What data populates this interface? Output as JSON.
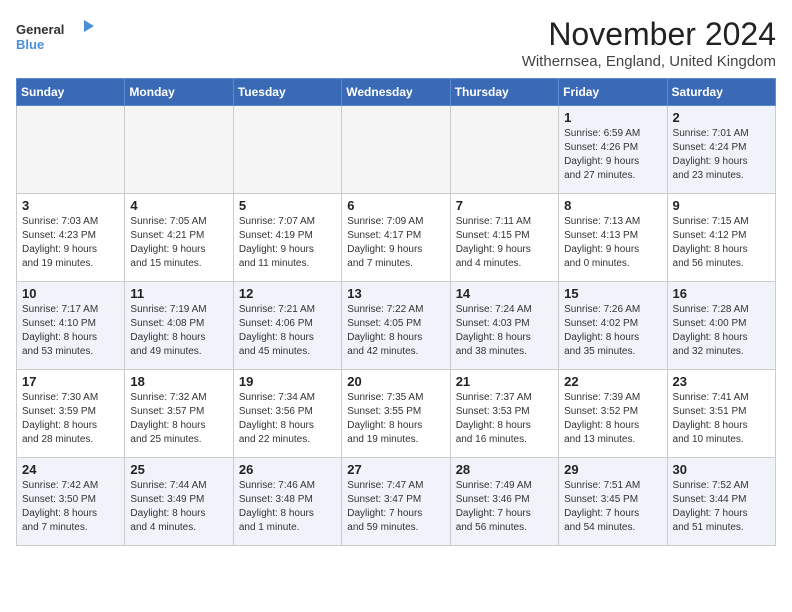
{
  "logo": {
    "line1": "General",
    "line2": "Blue"
  },
  "title": "November 2024",
  "location": "Withernsea, England, United Kingdom",
  "weekdays": [
    "Sunday",
    "Monday",
    "Tuesday",
    "Wednesday",
    "Thursday",
    "Friday",
    "Saturday"
  ],
  "weeks": [
    [
      {
        "day": "",
        "info": ""
      },
      {
        "day": "",
        "info": ""
      },
      {
        "day": "",
        "info": ""
      },
      {
        "day": "",
        "info": ""
      },
      {
        "day": "",
        "info": ""
      },
      {
        "day": "1",
        "info": "Sunrise: 6:59 AM\nSunset: 4:26 PM\nDaylight: 9 hours\nand 27 minutes."
      },
      {
        "day": "2",
        "info": "Sunrise: 7:01 AM\nSunset: 4:24 PM\nDaylight: 9 hours\nand 23 minutes."
      }
    ],
    [
      {
        "day": "3",
        "info": "Sunrise: 7:03 AM\nSunset: 4:23 PM\nDaylight: 9 hours\nand 19 minutes."
      },
      {
        "day": "4",
        "info": "Sunrise: 7:05 AM\nSunset: 4:21 PM\nDaylight: 9 hours\nand 15 minutes."
      },
      {
        "day": "5",
        "info": "Sunrise: 7:07 AM\nSunset: 4:19 PM\nDaylight: 9 hours\nand 11 minutes."
      },
      {
        "day": "6",
        "info": "Sunrise: 7:09 AM\nSunset: 4:17 PM\nDaylight: 9 hours\nand 7 minutes."
      },
      {
        "day": "7",
        "info": "Sunrise: 7:11 AM\nSunset: 4:15 PM\nDaylight: 9 hours\nand 4 minutes."
      },
      {
        "day": "8",
        "info": "Sunrise: 7:13 AM\nSunset: 4:13 PM\nDaylight: 9 hours\nand 0 minutes."
      },
      {
        "day": "9",
        "info": "Sunrise: 7:15 AM\nSunset: 4:12 PM\nDaylight: 8 hours\nand 56 minutes."
      }
    ],
    [
      {
        "day": "10",
        "info": "Sunrise: 7:17 AM\nSunset: 4:10 PM\nDaylight: 8 hours\nand 53 minutes."
      },
      {
        "day": "11",
        "info": "Sunrise: 7:19 AM\nSunset: 4:08 PM\nDaylight: 8 hours\nand 49 minutes."
      },
      {
        "day": "12",
        "info": "Sunrise: 7:21 AM\nSunset: 4:06 PM\nDaylight: 8 hours\nand 45 minutes."
      },
      {
        "day": "13",
        "info": "Sunrise: 7:22 AM\nSunset: 4:05 PM\nDaylight: 8 hours\nand 42 minutes."
      },
      {
        "day": "14",
        "info": "Sunrise: 7:24 AM\nSunset: 4:03 PM\nDaylight: 8 hours\nand 38 minutes."
      },
      {
        "day": "15",
        "info": "Sunrise: 7:26 AM\nSunset: 4:02 PM\nDaylight: 8 hours\nand 35 minutes."
      },
      {
        "day": "16",
        "info": "Sunrise: 7:28 AM\nSunset: 4:00 PM\nDaylight: 8 hours\nand 32 minutes."
      }
    ],
    [
      {
        "day": "17",
        "info": "Sunrise: 7:30 AM\nSunset: 3:59 PM\nDaylight: 8 hours\nand 28 minutes."
      },
      {
        "day": "18",
        "info": "Sunrise: 7:32 AM\nSunset: 3:57 PM\nDaylight: 8 hours\nand 25 minutes."
      },
      {
        "day": "19",
        "info": "Sunrise: 7:34 AM\nSunset: 3:56 PM\nDaylight: 8 hours\nand 22 minutes."
      },
      {
        "day": "20",
        "info": "Sunrise: 7:35 AM\nSunset: 3:55 PM\nDaylight: 8 hours\nand 19 minutes."
      },
      {
        "day": "21",
        "info": "Sunrise: 7:37 AM\nSunset: 3:53 PM\nDaylight: 8 hours\nand 16 minutes."
      },
      {
        "day": "22",
        "info": "Sunrise: 7:39 AM\nSunset: 3:52 PM\nDaylight: 8 hours\nand 13 minutes."
      },
      {
        "day": "23",
        "info": "Sunrise: 7:41 AM\nSunset: 3:51 PM\nDaylight: 8 hours\nand 10 minutes."
      }
    ],
    [
      {
        "day": "24",
        "info": "Sunrise: 7:42 AM\nSunset: 3:50 PM\nDaylight: 8 hours\nand 7 minutes."
      },
      {
        "day": "25",
        "info": "Sunrise: 7:44 AM\nSunset: 3:49 PM\nDaylight: 8 hours\nand 4 minutes."
      },
      {
        "day": "26",
        "info": "Sunrise: 7:46 AM\nSunset: 3:48 PM\nDaylight: 8 hours\nand 1 minute."
      },
      {
        "day": "27",
        "info": "Sunrise: 7:47 AM\nSunset: 3:47 PM\nDaylight: 7 hours\nand 59 minutes."
      },
      {
        "day": "28",
        "info": "Sunrise: 7:49 AM\nSunset: 3:46 PM\nDaylight: 7 hours\nand 56 minutes."
      },
      {
        "day": "29",
        "info": "Sunrise: 7:51 AM\nSunset: 3:45 PM\nDaylight: 7 hours\nand 54 minutes."
      },
      {
        "day": "30",
        "info": "Sunrise: 7:52 AM\nSunset: 3:44 PM\nDaylight: 7 hours\nand 51 minutes."
      }
    ]
  ]
}
